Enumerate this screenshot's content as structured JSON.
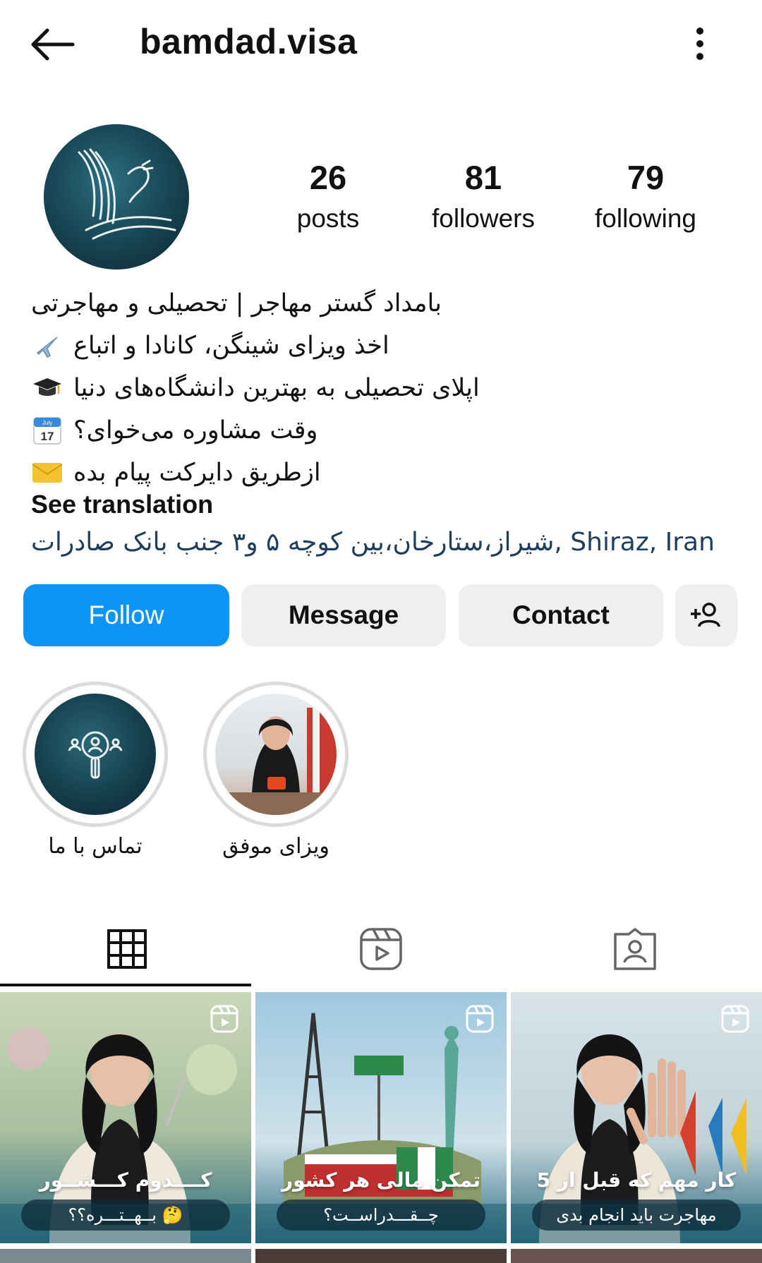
{
  "header": {
    "username": "bamdad.visa"
  },
  "stats": {
    "posts": {
      "count": "26",
      "label": "posts"
    },
    "followers": {
      "count": "81",
      "label": "followers"
    },
    "following": {
      "count": "79",
      "label": "following"
    }
  },
  "bio": {
    "lines": [
      {
        "text": "بامداد گستر مهاجر | تحصیلی و مهاجرتی",
        "emoji": ""
      },
      {
        "text": "اخذ ویزای شینگن، کانادا و اتباع",
        "emoji": "airplane-icon"
      },
      {
        "text": "اپلای تحصیلی به بهترین دانشگاه‌های دنیا",
        "emoji": "graduation-cap-icon"
      },
      {
        "text": "وقت مشاوره می‌خوای؟",
        "emoji": "calendar-icon"
      },
      {
        "text": "ازطریق دایرکت پیام بده",
        "emoji": "envelope-icon"
      }
    ],
    "see_translation": "See translation",
    "address": "شیراز،ستارخان،بین کوچه ۵ و۳ جنب بانک صادرات, Shiraz, Iran"
  },
  "calendar_emoji": {
    "month": "July",
    "day": "17"
  },
  "buttons": {
    "follow": "Follow",
    "message": "Message",
    "contact": "Contact"
  },
  "highlights": [
    {
      "label": "تماس با ما"
    },
    {
      "label": "ویزای موفق"
    }
  ],
  "tabs": [
    "grid-icon",
    "reels-icon",
    "tagged-icon"
  ],
  "posts": [
    {
      "title": "کــــدوم کـــشــور",
      "subtitle": "بــهــتـــره؟؟ 🤔"
    },
    {
      "title": "تمکن مالی هر کشور",
      "subtitle": "چــقـــدراســت؟"
    },
    {
      "title": "5 کار مهم که قبل از",
      "subtitle": "مهاجرت باید انجام بدی"
    }
  ],
  "colors": {
    "follow_blue": "#0c95f5",
    "button_gray": "#efefef",
    "link_blue": "#1f3d5c"
  }
}
